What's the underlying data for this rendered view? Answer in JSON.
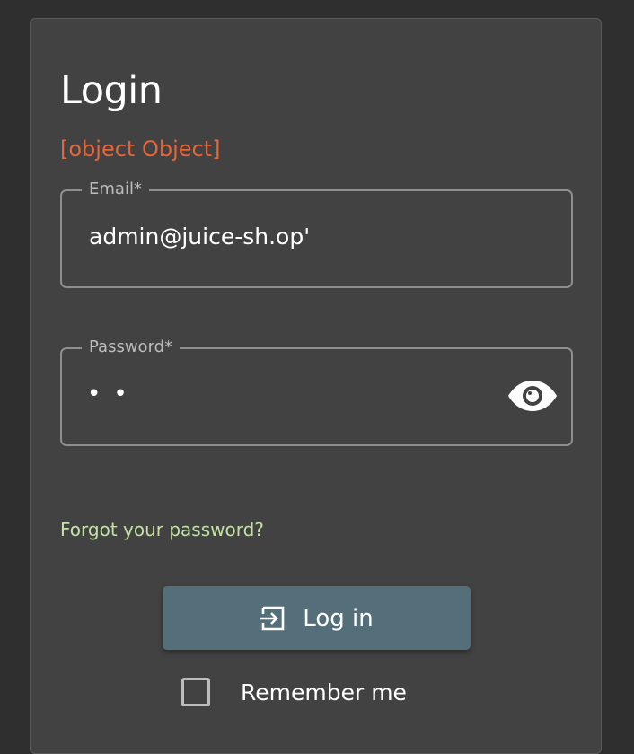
{
  "login": {
    "title": "Login",
    "error_message": "[object Object]",
    "email": {
      "label": "Email*",
      "value": "admin@juice-sh.op'"
    },
    "password": {
      "label": "Password*",
      "masked_value": "••",
      "toggle_icon": "eye-icon"
    },
    "forgot_password_link": "Forgot your password?",
    "login_button": {
      "label": "Log in",
      "icon": "login-icon"
    },
    "remember_me": {
      "label": "Remember me",
      "checked": false
    }
  },
  "colors": {
    "background": "#2f2f2f",
    "card": "#424242",
    "error": "#e4663b",
    "link": "#c5e1a5",
    "button": "#546e7a"
  }
}
